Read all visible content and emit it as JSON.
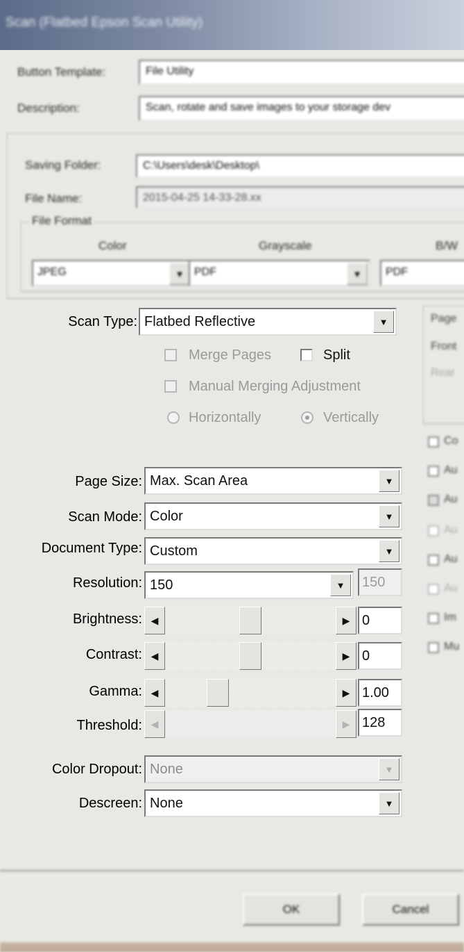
{
  "window": {
    "title": "Scan (Flatbed Epson Scan Utility)"
  },
  "top": {
    "button_template_label": "Button Template:",
    "button_template_value": "File Utility",
    "description_label": "Description:",
    "description_value": "Scan, rotate and save images to your storage dev"
  },
  "saving": {
    "folder_label": "Saving Folder:",
    "folder_value": "C:\\Users\\desk\\Desktop\\",
    "filename_label": "File Name:",
    "filename_value": "2015-04-25 14-33-28.xx",
    "format_group": "File Format",
    "color_label": "Color",
    "grayscale_label": "Grayscale",
    "bw_label": "B/W",
    "color_value": "JPEG",
    "grayscale_value": "PDF",
    "bw_value": "PDF"
  },
  "scan": {
    "scan_type_label": "Scan Type:",
    "scan_type_value": "Flatbed Reflective",
    "merge_pages": "Merge Pages",
    "split": "Split",
    "manual_merging": "Manual Merging Adjustment",
    "horizontally": "Horizontally",
    "vertically": "Vertically",
    "page_size_label": "Page Size:",
    "page_size_value": "Max. Scan Area",
    "scan_mode_label": "Scan Mode:",
    "scan_mode_value": "Color",
    "document_type_label": "Document Type:",
    "document_type_value": "Custom",
    "resolution_label": "Resolution:",
    "resolution_value": "150",
    "resolution_custom": "150",
    "brightness_label": "Brightness:",
    "brightness_value": "0",
    "brightness_pos": 0.5,
    "contrast_label": "Contrast:",
    "contrast_value": "0",
    "contrast_pos": 0.5,
    "gamma_label": "Gamma:",
    "gamma_value": "1.00",
    "gamma_pos": 0.28,
    "threshold_label": "Threshold:",
    "threshold_value": "128",
    "color_dropout_label": "Color Dropout:",
    "color_dropout_value": "None",
    "descreen_label": "Descreen:",
    "descreen_value": "None"
  },
  "right": {
    "group_title": "Page",
    "line1": "Front",
    "line2": "Rear",
    "checks": [
      "Co",
      "Au",
      "Au",
      "Au",
      "Au",
      "Au",
      "Im",
      "Mu"
    ]
  },
  "footer": {
    "ok_label": "OK",
    "cancel_label": "Cancel"
  },
  "icons": {
    "dropdown": "dropdown-arrow-icon",
    "scroll_left": "left-arrow-icon",
    "scroll_right": "right-arrow-icon"
  }
}
